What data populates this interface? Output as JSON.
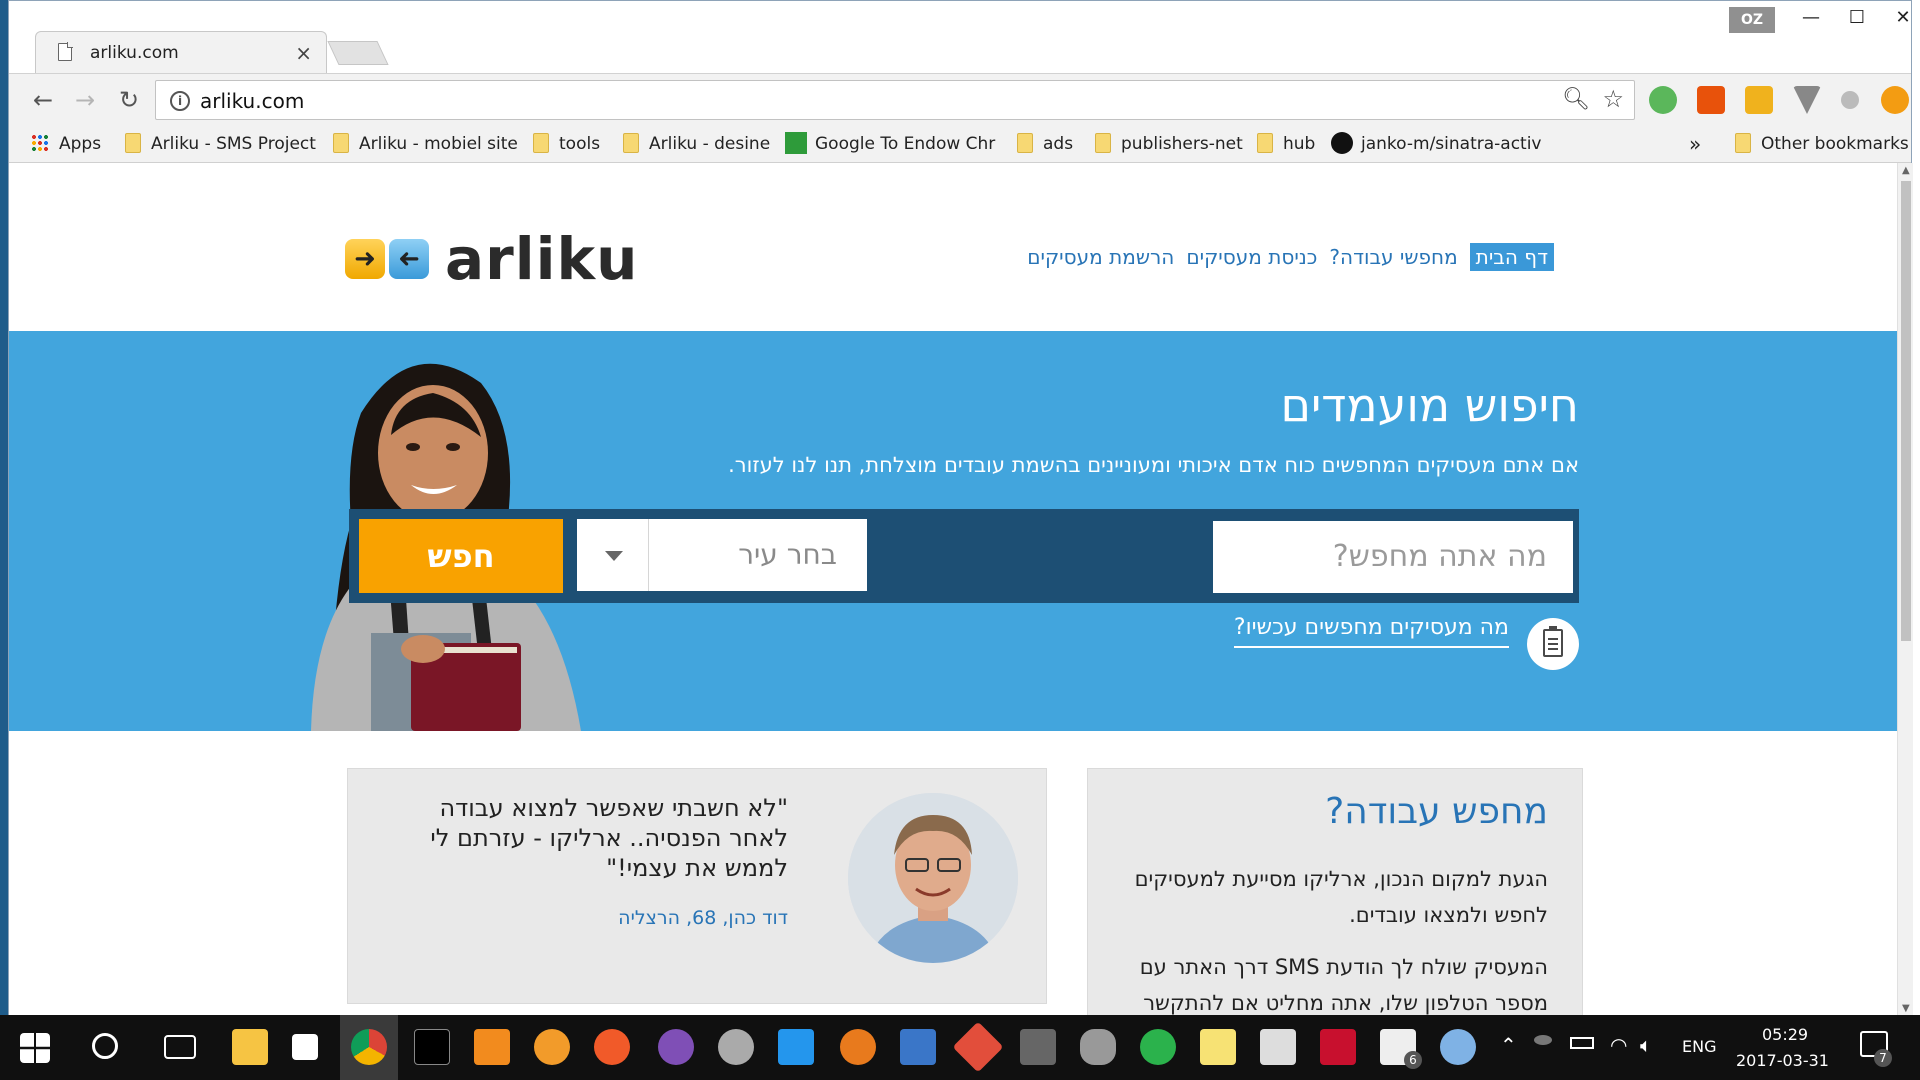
{
  "browser": {
    "tab_title": "arliku.com",
    "tab_close": "×",
    "user_badge": "OZ",
    "window_minimize": "—",
    "window_maximize": "☐",
    "window_close": "✕",
    "url": "arliku.com",
    "bookmarks": [
      "Apps",
      "Arliku - SMS Project",
      "Arliku - mobiel site",
      "tools",
      "Arliku - desine",
      "Google To Endow Chr",
      "ads",
      "publishers-net",
      "hub",
      "janko-m/sinatra-activ"
    ],
    "bookmarks_overflow": "»",
    "other_bookmarks": "Other bookmarks"
  },
  "page": {
    "logo_text": "arliku",
    "nav": [
      "דף הבית",
      "מחפשי עבודה?",
      "כניסת מעסיקים",
      "הרשמת מעסיקים"
    ],
    "hero": {
      "title": "חיפוש מועמדים",
      "subtitle": "אם אתם מעסיקים המחפשים כוח אדם איכותי ומעוניינים בהשמת עובדים מוצלחת, תנו לנו לעזור.",
      "what_placeholder": "מה אתה מחפש?",
      "city_placeholder": "בחר עיר",
      "search_button": "חפש",
      "employers_link": "מה מעסיקים מחפשים עכשיו?"
    },
    "testimonial": {
      "quote": "\"לא חשבתי שאפשר למצוא עבודה לאחר הפנסיה.. ארליקו - עזרתם לי לממש את עצמי!\"",
      "author": "דוד כהן, 68, הרצליה"
    },
    "job_seekers": {
      "title": "מחפש עבודה?",
      "paragraph1": "הגעת למקום הנכון, ארליקו מסייעת למעסיקים לחפש ולמצאו עובדים.",
      "paragraph2": "המעסיק שולח לך הודעת SMS דרך האתר עם מספר הטלפון שלו, אתה מחליט אם להתקשר"
    }
  },
  "taskbar": {
    "language": "ENG",
    "time": "05:29",
    "date": "2017-03-31",
    "mail_count": "6",
    "notifications_count": "7"
  },
  "colors": {
    "hero_bg": "#42a5dd",
    "search_bar_bg": "#1d4f74",
    "search_button": "#f9a200",
    "link_blue": "#2874b6"
  }
}
